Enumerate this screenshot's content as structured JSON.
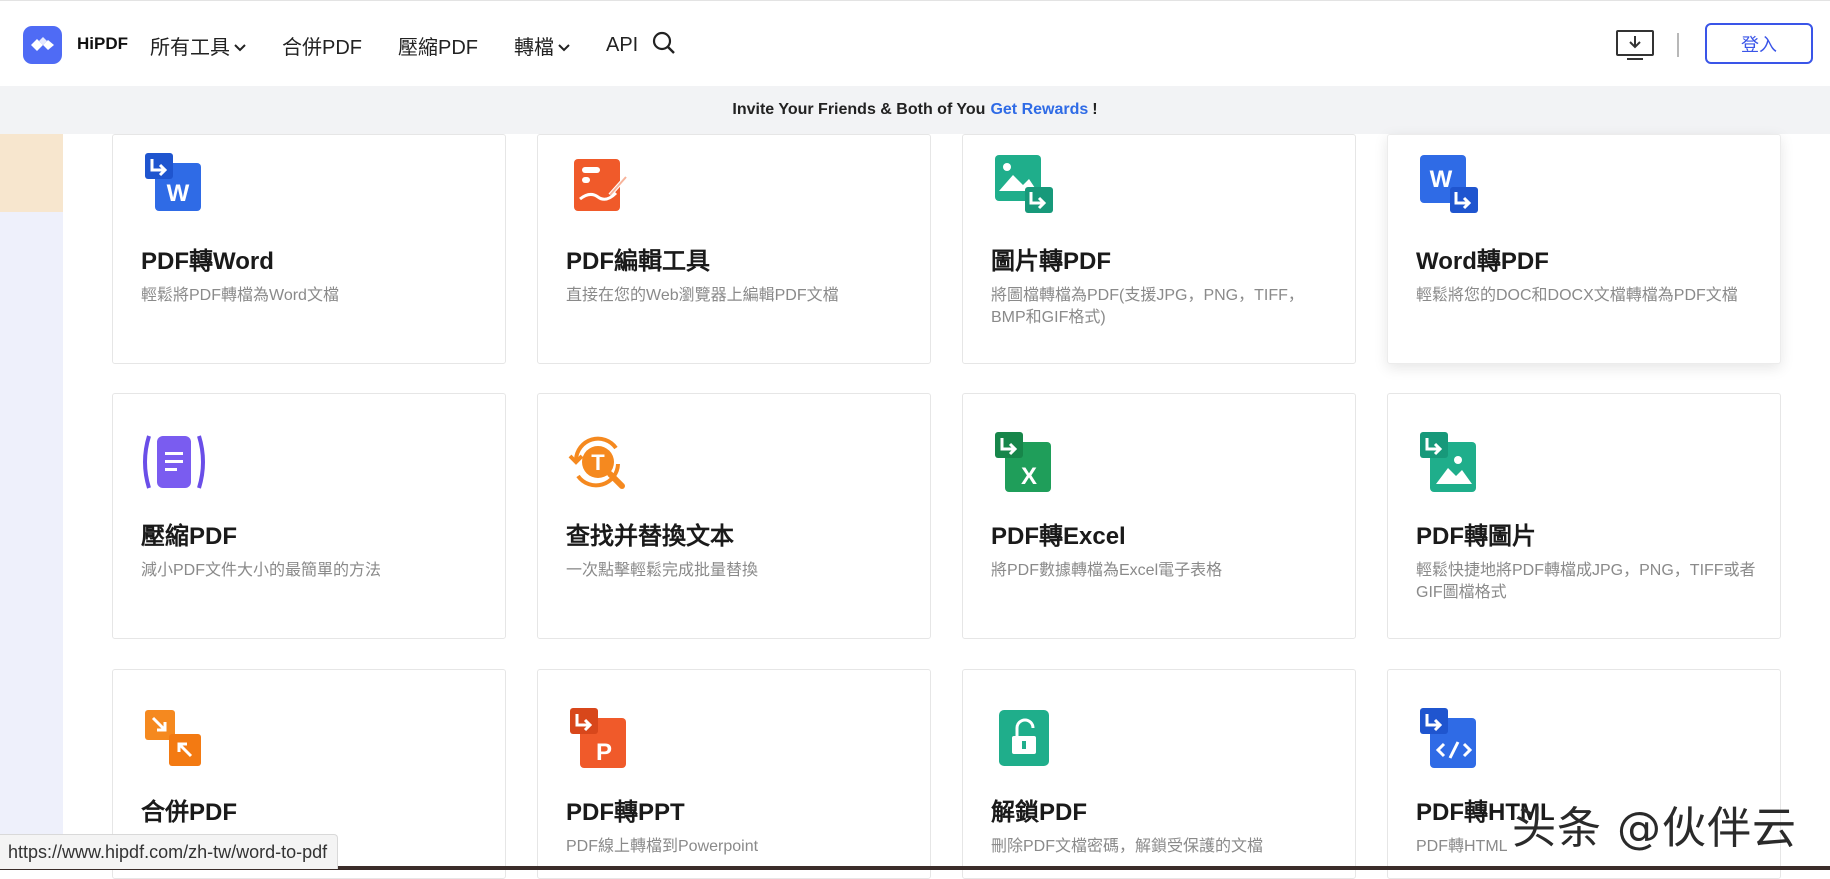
{
  "header": {
    "brand": "HiPDF",
    "nav": [
      {
        "label": "所有工具",
        "has_dropdown": true
      },
      {
        "label": "合併PDF",
        "has_dropdown": false
      },
      {
        "label": "壓縮PDF",
        "has_dropdown": false
      },
      {
        "label": "轉檔",
        "has_dropdown": true
      },
      {
        "label": "API",
        "has_dropdown": false
      }
    ],
    "login_label": "登入",
    "icons": {
      "search": "search-icon",
      "download": "download-icon",
      "logo": "hipdf-logo-icon"
    }
  },
  "promo": {
    "text_before": "Invite Your Friends & Both of You",
    "link": "Get Rewards",
    "text_after": "!"
  },
  "tools": [
    {
      "title": "PDF轉Word",
      "desc": "輕鬆將PDF轉檔為Word文檔",
      "icon": "pdf-to-word-icon",
      "color": "#2f6be6"
    },
    {
      "title": "PDF編輯工具",
      "desc": "直接在您的Web瀏覽器上編輯PDF文檔",
      "icon": "pdf-edit-icon",
      "color": "#f05a2a"
    },
    {
      "title": "圖片轉PDF",
      "desc": "將圖檔轉檔為PDF(支援JPG，PNG，TIFF，BMP和GIF格式)",
      "icon": "image-to-pdf-icon",
      "color": "#1fae8b"
    },
    {
      "title": "Word轉PDF",
      "desc": "輕鬆將您的DOC和DOCX文檔轉檔為PDF文檔",
      "icon": "word-to-pdf-icon",
      "color": "#2f6be6"
    },
    {
      "title": "壓縮PDF",
      "desc": "減小PDF文件大小的最簡單的方法",
      "icon": "compress-pdf-icon",
      "color": "#6a4ee8"
    },
    {
      "title": "查找并替換文本",
      "desc": "一次點擊輕鬆完成批量替換",
      "icon": "find-replace-icon",
      "color": "#f5891f"
    },
    {
      "title": "PDF轉Excel",
      "desc": "將PDF數據轉檔為Excel電子表格",
      "icon": "pdf-to-excel-icon",
      "color": "#1f9e5a"
    },
    {
      "title": "PDF轉圖片",
      "desc": "輕鬆快捷地將PDF轉檔成JPG，PNG，TIFF或者GIF圖檔格式",
      "icon": "pdf-to-image-icon",
      "color": "#1fae8b"
    },
    {
      "title": "合併PDF",
      "desc": "",
      "icon": "merge-pdf-icon",
      "color": "#f5891f"
    },
    {
      "title": "PDF轉PPT",
      "desc": "PDF線上轉檔到Powerpoint",
      "icon": "pdf-to-ppt-icon",
      "color": "#f05a2a"
    },
    {
      "title": "解鎖PDF",
      "desc": "刪除PDF文檔密碼，解鎖受保護的文檔",
      "icon": "unlock-pdf-icon",
      "color": "#1fae8b"
    },
    {
      "title": "PDF轉HTML",
      "desc": "PDF轉HTML",
      "icon": "pdf-to-html-icon",
      "color": "#2f6be6"
    }
  ],
  "status_url": "https://www.hipdf.com/zh-tw/word-to-pdf",
  "watermark": "头条 @伙伴云"
}
